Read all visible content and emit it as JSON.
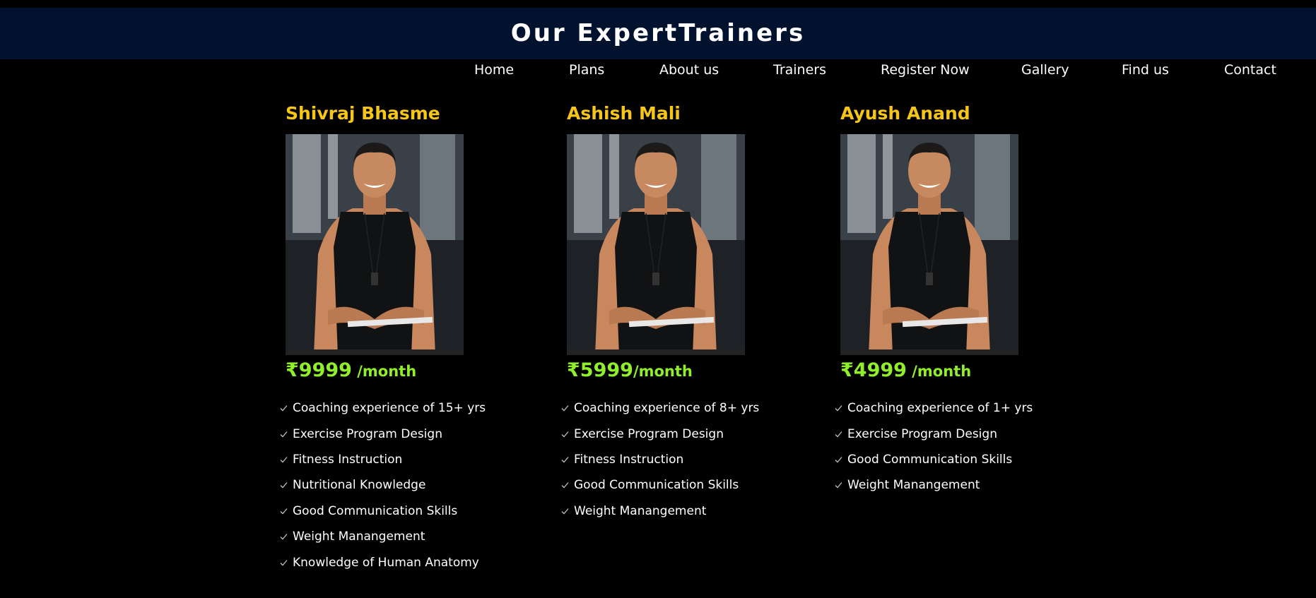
{
  "header": {
    "title": "Our ExpertTrainers"
  },
  "nav": {
    "items": [
      {
        "label": "Home"
      },
      {
        "label": "Plans"
      },
      {
        "label": "About us"
      },
      {
        "label": "Trainers"
      },
      {
        "label": "Register Now"
      },
      {
        "label": "Gallery"
      },
      {
        "label": "Find us"
      },
      {
        "label": "Contact"
      }
    ]
  },
  "trainers": [
    {
      "name": "Shivraj Bhasme",
      "price": "₹9999",
      "per": " /month",
      "features": [
        "Coaching experience of 15+ yrs",
        "Exercise Program Design",
        "Fitness Instruction",
        "Nutritional Knowledge",
        "Good Communication Skills",
        "Weight Manangement",
        "Knowledge of Human Anatomy"
      ]
    },
    {
      "name": "Ashish Mali",
      "price": "₹5999",
      "per": "/month",
      "features": [
        "Coaching experience of 8+ yrs",
        "Exercise Program Design",
        "Fitness Instruction",
        "Good Communication Skills",
        "Weight Manangement"
      ]
    },
    {
      "name": "Ayush Anand",
      "price": "₹4999",
      "per": " /month",
      "features": [
        "Coaching experience of 1+ yrs",
        "Exercise Program Design",
        "Good Communication Skills",
        "Weight Manangement"
      ]
    }
  ],
  "colors": {
    "header_bg": "#00122e",
    "page_bg": "#000000",
    "name": "#f5c518",
    "price": "#90ee2a",
    "text": "#ffffff"
  },
  "icons": {
    "feature_bullet": "check-icon",
    "photo": "trainer-photo"
  }
}
